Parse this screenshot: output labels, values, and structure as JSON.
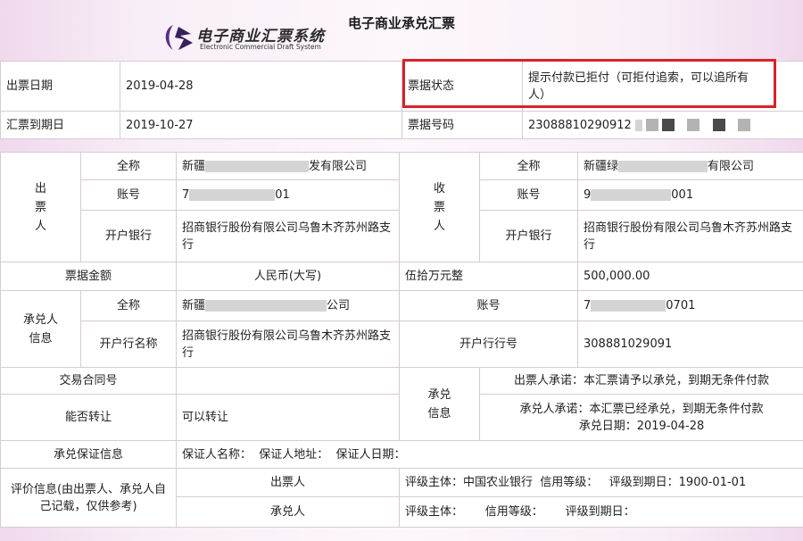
{
  "header": {
    "title": "电子商业承兑汇票",
    "logo_cn": "电子商业汇票系统",
    "logo_en": "Electronic Commercial Draft System"
  },
  "top": {
    "issue_date_label": "出票日期",
    "issue_date": "2019-04-28",
    "status_label": "票据状态",
    "status_line1": "提示付款已拒付（可拒付追索，可以追所有",
    "status_line2": "人）",
    "due_date_label": "汇票到期日",
    "due_date": "2019-10-27",
    "number_label": "票据号码",
    "number_prefix": "23088810290912"
  },
  "drawer": {
    "label": "出票人",
    "name_label": "全称",
    "name_start": "新疆",
    "name_end": "发有限公司",
    "account_label": "账号",
    "account_start": "7",
    "account_end": "01",
    "bank_label": "开户银行",
    "bank": "招商银行股份有限公司乌鲁木齐苏州路支行"
  },
  "payee": {
    "label": "收票人",
    "name_label": "全称",
    "name_start": "新疆绿",
    "name_end": "有限公司",
    "account_label": "账号",
    "account_start": "9",
    "account_end": "001",
    "bank_label": "开户银行",
    "bank": "招商银行股份有限公司乌鲁木齐苏州路支行"
  },
  "amount": {
    "label": "票据金额",
    "currency": "人民币(大写)",
    "in_words": "伍拾万元整",
    "value": "500,000.00"
  },
  "acceptor": {
    "label": "承兑人信息",
    "name_label": "全称",
    "name_start": "新疆",
    "name_end": "公司",
    "account_label": "账号",
    "account_start": "7",
    "account_end": "0701",
    "bank_label": "开户行名称",
    "bank": "招商银行股份有限公司乌鲁木齐苏州路支行",
    "bank_no_label": "开户行行号",
    "bank_no": "308881029091"
  },
  "transaction": {
    "contract_label": "交易合同号",
    "transfer_label": "能否转让",
    "transfer_value": "可以转让",
    "accept_info_label": "承兑信息",
    "drawer_promise": "出票人承诺：本汇票请予以承兑，到期无条件付款",
    "acceptor_promise": "承兑人承诺：本汇票已经承兑，到期无条件付款",
    "accept_date": "承兑日期：2019-04-28"
  },
  "guarantee": {
    "label": "承兑保证信息",
    "value": "保证人名称：  保证人地址：  保证人日期："
  },
  "rating": {
    "label": "评价信息(由出票人、承兑人自己记载，仅供参考)",
    "drawer_label": "出票人",
    "drawer_value": "评级主体：中国农业银行  信用等级：   评级到期日：1900-01-01",
    "acceptor_label": "承兑人",
    "acceptor_value": "评级主体：      信用等级：      评级到期日："
  }
}
